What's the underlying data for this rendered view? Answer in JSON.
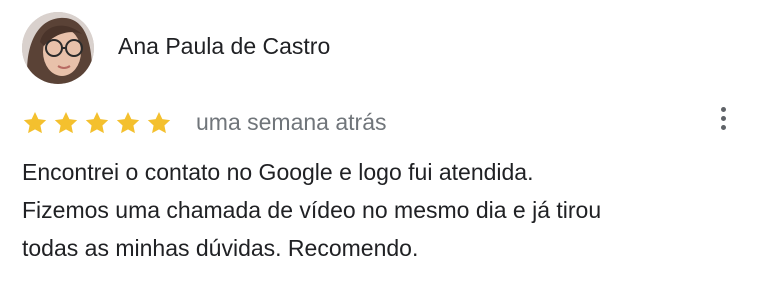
{
  "review": {
    "author_name": "Ana Paula de Castro",
    "rating": 5,
    "rating_max": 5,
    "date": "uma semana atrás",
    "text_lines": [
      "Encontrei o contato no Google e logo fui atendida.",
      "Fizemos uma chamada de vídeo no mesmo dia e já tirou",
      "todas as minhas dúvidas. Recomendo."
    ]
  },
  "colors": {
    "star": "#f4c02e",
    "name": "#202124",
    "date": "#70757a",
    "text": "#202124",
    "menu_dots": "#5f6368"
  },
  "icons": {
    "more": "more-vert-icon",
    "star": "star-icon"
  }
}
